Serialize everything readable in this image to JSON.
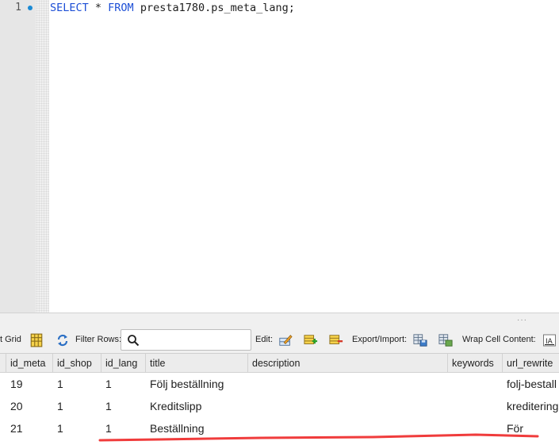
{
  "editor": {
    "line_number": "1",
    "query": {
      "kw_select": "SELECT",
      "star": " * ",
      "kw_from": "FROM",
      "rest": " presta1780.ps_meta_lang;"
    }
  },
  "toolbar": {
    "result_grid_label": "t Grid",
    "filter_rows_label": "Filter Rows:",
    "filter_value": "",
    "edit_label": "Edit:",
    "export_label": "Export/Import:",
    "wrap_label": "Wrap Cell Content:"
  },
  "grid": {
    "columns": [
      "id_meta",
      "id_shop",
      "id_lang",
      "title",
      "description",
      "keywords",
      "url_rewrite"
    ],
    "rows": [
      [
        "19",
        "1",
        "1",
        "Följ beställning",
        "",
        "",
        "folj-bestall"
      ],
      [
        "20",
        "1",
        "1",
        "Kreditslipp",
        "",
        "",
        "kreditering"
      ],
      [
        "21",
        "1",
        "1",
        "Beställning",
        "",
        "",
        "För"
      ]
    ]
  },
  "annotation": {
    "color": "#f03c3c"
  }
}
